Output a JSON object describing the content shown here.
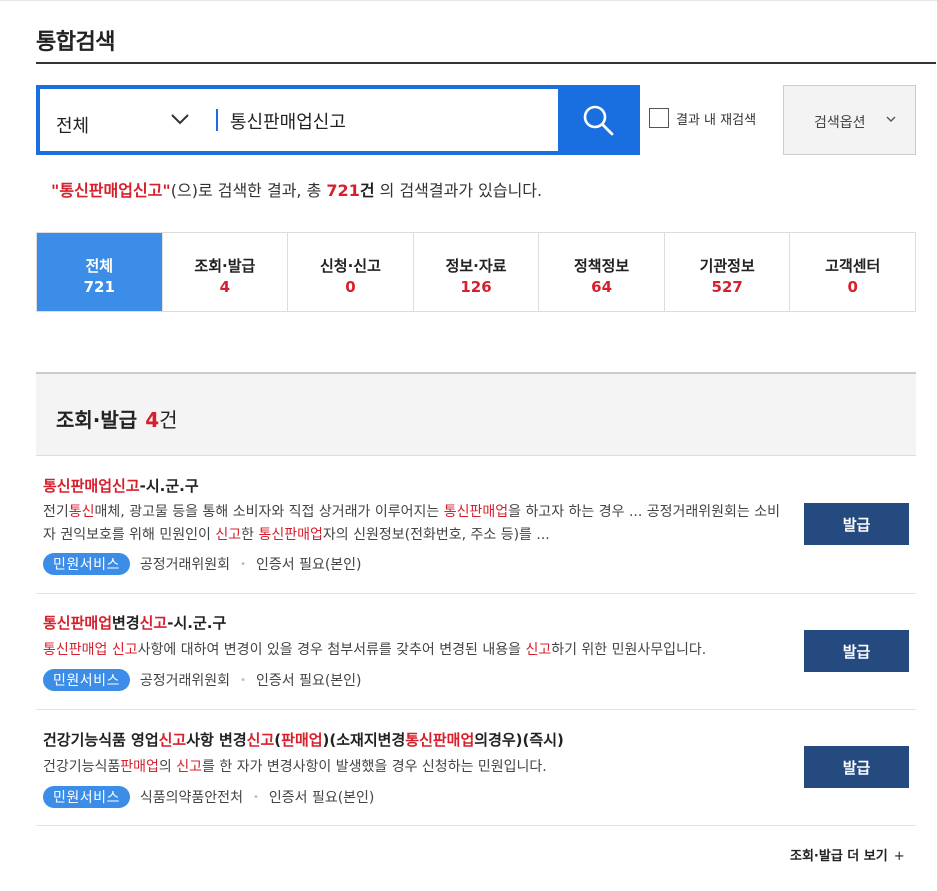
{
  "page": {
    "title": "통합검색"
  },
  "search": {
    "scope": "전체",
    "query": "통신판매업신고",
    "research_label": "결과 내 재검색",
    "options_label": "검색옵션"
  },
  "summary": {
    "open_quote": "\"",
    "keyword": "통신판매업신고",
    "close_quote": "\"",
    "text_before_count": "(으)로 검색한 결과, 총 ",
    "count": "721",
    "unit": "건",
    "text_after": " 의 검색결과가 있습니다."
  },
  "tabs": [
    {
      "label": "전체",
      "count": "721"
    },
    {
      "label": "조회·발급",
      "count": "4"
    },
    {
      "label": "신청·신고",
      "count": "0"
    },
    {
      "label": "정보·자료",
      "count": "126"
    },
    {
      "label": "정책정보",
      "count": "64"
    },
    {
      "label": "기관정보",
      "count": "527"
    },
    {
      "label": "고객센터",
      "count": "0"
    }
  ],
  "section": {
    "title": "조회·발급",
    "count": "4",
    "unit": "건"
  },
  "results": [
    {
      "title": [
        {
          "text": "통신판매업신고",
          "hl": true
        },
        {
          "text": "-시.군.구",
          "hl": false
        }
      ],
      "desc": [
        {
          "text": "전기",
          "hl": false
        },
        {
          "text": "통신",
          "hl": true
        },
        {
          "text": "매체, 광고물 등을 통해 소비자와 직접 상거래가 이루어지는 ",
          "hl": false
        },
        {
          "text": "통신판매업",
          "hl": true
        },
        {
          "text": "을 하고자 하는 경우 ... 공정거래위원회는 소비자 권익보호를 위해 민원인이 ",
          "hl": false
        },
        {
          "text": "신고",
          "hl": true
        },
        {
          "text": "한 ",
          "hl": false
        },
        {
          "text": "통신판매업",
          "hl": true
        },
        {
          "text": "자의 신원정보(전화번호, 주소 등)를 ...",
          "hl": false
        }
      ],
      "badge": "민원서비스",
      "agency": "공정거래위원회",
      "cert": "인증서 필요(본인)",
      "button": "발급"
    },
    {
      "title": [
        {
          "text": "통신판매업",
          "hl": true
        },
        {
          "text": "변경",
          "hl": false
        },
        {
          "text": "신고",
          "hl": true
        },
        {
          "text": "-시.군.구",
          "hl": false
        }
      ],
      "desc": [
        {
          "text": "통신판매업 신고",
          "hl": true
        },
        {
          "text": "사항에 대하여 변경이 있을 경우 첨부서류를 갖추어 변경된 내용을 ",
          "hl": false
        },
        {
          "text": "신고",
          "hl": true
        },
        {
          "text": "하기 위한 민원사무입니다.",
          "hl": false
        }
      ],
      "badge": "민원서비스",
      "agency": "공정거래위원회",
      "cert": "인증서 필요(본인)",
      "button": "발급"
    },
    {
      "title": [
        {
          "text": "건강기능식품 영업",
          "hl": false
        },
        {
          "text": "신고",
          "hl": true
        },
        {
          "text": "사항 변경",
          "hl": false
        },
        {
          "text": "신고",
          "hl": true
        },
        {
          "text": "(",
          "hl": false
        },
        {
          "text": "판매업",
          "hl": true
        },
        {
          "text": ")(소재지변경",
          "hl": false
        },
        {
          "text": "통신판매업",
          "hl": true
        },
        {
          "text": "의경우)(즉시)",
          "hl": false
        }
      ],
      "desc": [
        {
          "text": "건강기능식품",
          "hl": false
        },
        {
          "text": "판매업",
          "hl": true
        },
        {
          "text": "의 ",
          "hl": false
        },
        {
          "text": "신고",
          "hl": true
        },
        {
          "text": "를 한 자가 변경사항이 발생했을 경우 신청하는 민원입니다.",
          "hl": false
        }
      ],
      "badge": "민원서비스",
      "agency": "식품의약품안전처",
      "cert": "인증서 필요(본인)",
      "button": "발급"
    }
  ],
  "more": {
    "label": "조회·발급 더 보기",
    "plus": "+"
  },
  "colors": {
    "accent": "#1a6fe0",
    "active_tab": "#3b8de8",
    "highlight": "#d6202d",
    "issue_button": "#244a7f"
  }
}
